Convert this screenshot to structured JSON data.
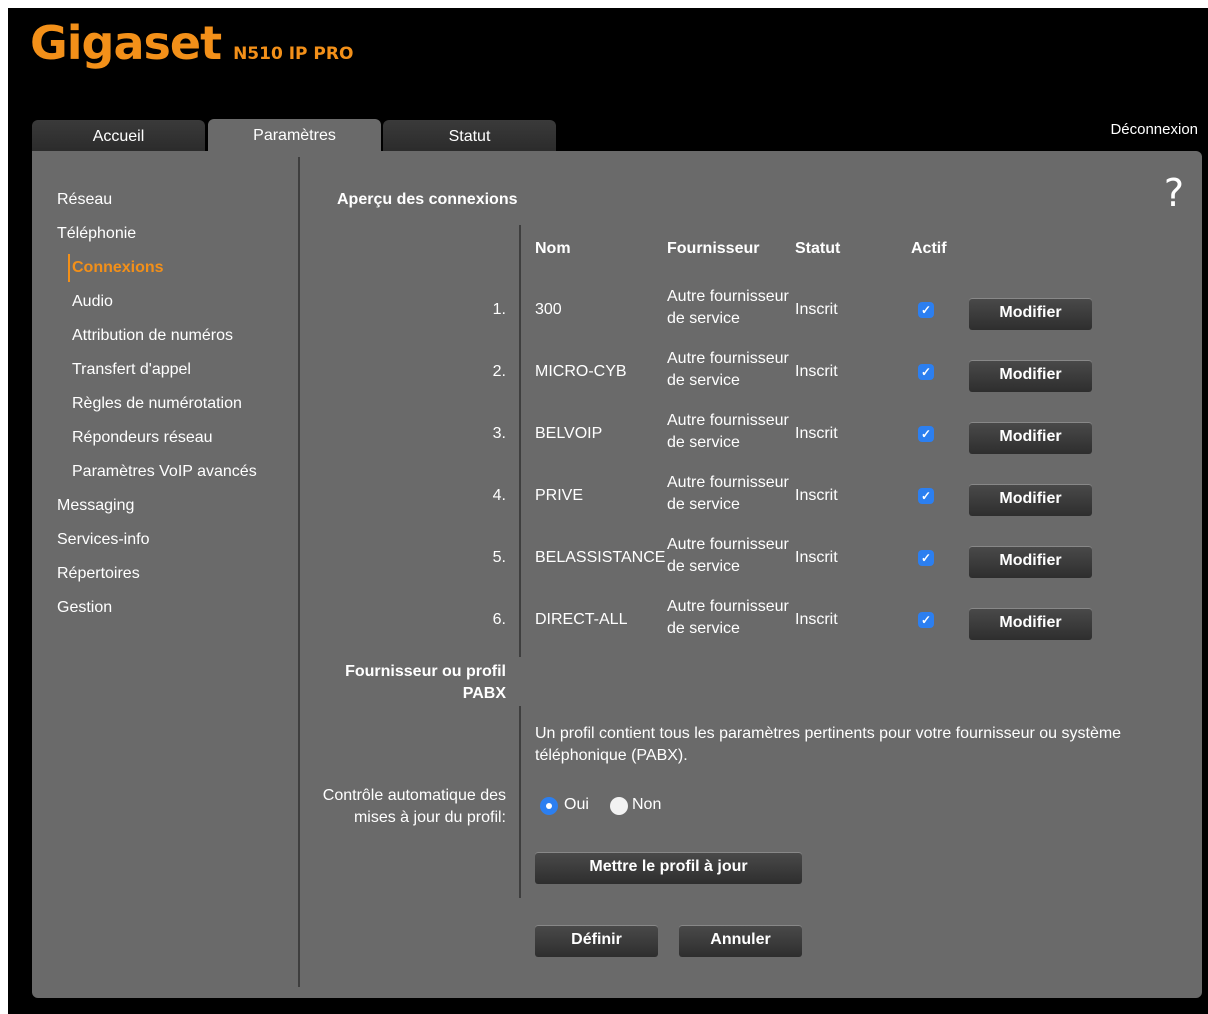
{
  "header": {
    "brand": "Gigaset",
    "model": "N510 IP PRO"
  },
  "tabs": [
    {
      "label": "Accueil"
    },
    {
      "label": "Paramètres"
    },
    {
      "label": "Statut"
    }
  ],
  "logout_label": "Déconnexion",
  "help_label": "?",
  "sidebar": {
    "items": [
      {
        "label": "Réseau"
      },
      {
        "label": "Téléphonie"
      },
      {
        "label": "Connexions"
      },
      {
        "label": "Audio"
      },
      {
        "label": "Attribution de numéros"
      },
      {
        "label": "Transfert d'appel"
      },
      {
        "label": "Règles de numérotation"
      },
      {
        "label": "Répondeurs réseau"
      },
      {
        "label": "Paramètres VoIP avancés"
      },
      {
        "label": "Messaging"
      },
      {
        "label": "Services-info"
      },
      {
        "label": "Répertoires"
      },
      {
        "label": "Gestion"
      }
    ]
  },
  "main": {
    "section_title": "Aperçu des connexions",
    "columns": {
      "name": "Nom",
      "provider": "Fournisseur",
      "status": "Statut",
      "active": "Actif"
    },
    "connections": [
      {
        "num": "1.",
        "name": "300",
        "provider_line1": "Autre fournisseur",
        "provider_line2": "de service",
        "status": "Inscrit",
        "active": true,
        "button": "Modifier"
      },
      {
        "num": "2.",
        "name": "MICRO-CYB",
        "provider_line1": "Autre fournisseur",
        "provider_line2": "de service",
        "status": "Inscrit",
        "active": true,
        "button": "Modifier"
      },
      {
        "num": "3.",
        "name": "BELVOIP",
        "provider_line1": "Autre fournisseur",
        "provider_line2": "de service",
        "status": "Inscrit",
        "active": true,
        "button": "Modifier"
      },
      {
        "num": "4.",
        "name": "PRIVE",
        "provider_line1": "Autre fournisseur",
        "provider_line2": "de service",
        "status": "Inscrit",
        "active": true,
        "button": "Modifier"
      },
      {
        "num": "5.",
        "name": "BELASSISTANCE",
        "provider_line1": "Autre fournisseur",
        "provider_line2": "de service",
        "status": "Inscrit",
        "active": true,
        "button": "Modifier"
      },
      {
        "num": "6.",
        "name": "DIRECT-ALL",
        "provider_line1": "Autre fournisseur",
        "provider_line2": "de service",
        "status": "Inscrit",
        "active": true,
        "button": "Modifier"
      }
    ],
    "profile_title_line1": "Fournisseur ou profil",
    "profile_title_line2": "PABX",
    "profile_desc_line1": "Un profil contient tous les paramètres pertinents pour votre fournisseur ou système",
    "profile_desc_line2": "téléphonique (PABX).",
    "auto_check_line1": "Contrôle automatique des",
    "auto_check_line2": "mises à jour du profil:",
    "radio_yes": "Oui",
    "radio_no": "Non",
    "auto_check_selected": "Oui",
    "update_button": "Mettre le profil à jour",
    "define_button": "Définir",
    "cancel_button": "Annuler"
  },
  "colors": {
    "accent": "#f39019",
    "panel": "#6a6a6a",
    "checkbox": "#2c7ff0"
  }
}
